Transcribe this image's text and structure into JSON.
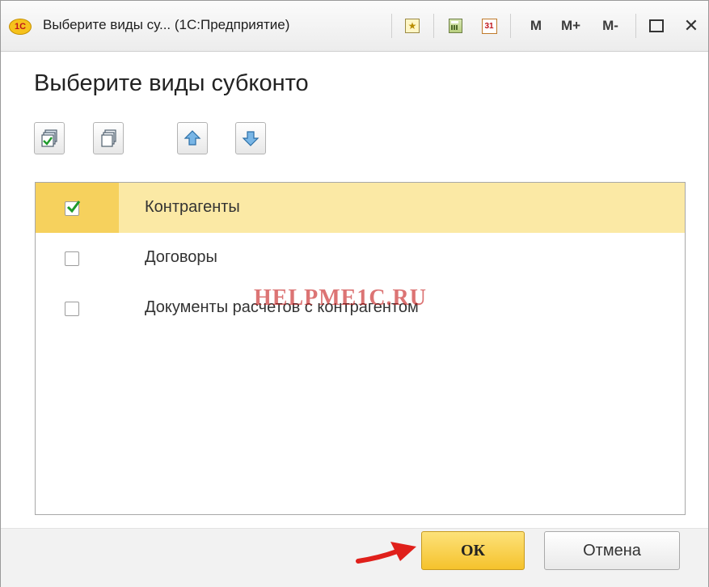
{
  "window": {
    "title": "Выберите виды су...  (1С:Предприятие)",
    "logo_text": "1С",
    "calendar_day": "31",
    "memory": {
      "m": "M",
      "m_plus": "M+",
      "m_minus": "M-"
    },
    "close_glyph": "✕"
  },
  "form": {
    "title": "Выберите виды субконто"
  },
  "toolbar": {
    "icons": [
      "check-all-icon",
      "uncheck-all-icon",
      "move-up-icon",
      "move-down-icon"
    ]
  },
  "list": {
    "items": [
      {
        "label": "Контрагенты",
        "checked": true,
        "selected": true
      },
      {
        "label": "Договоры",
        "checked": false,
        "selected": false
      },
      {
        "label": "Документы расчетов с контрагентом",
        "checked": false,
        "selected": false
      }
    ]
  },
  "watermark": "HELPME1C.RU",
  "buttons": {
    "ok": "ОК",
    "cancel": "Отмена"
  },
  "colors": {
    "selection_row": "#fbe9a5",
    "selection_cell": "#f6d15d",
    "ok_button": "#f5c22c",
    "arrow": "#e0201b",
    "check_mark": "#1e9a2a"
  }
}
